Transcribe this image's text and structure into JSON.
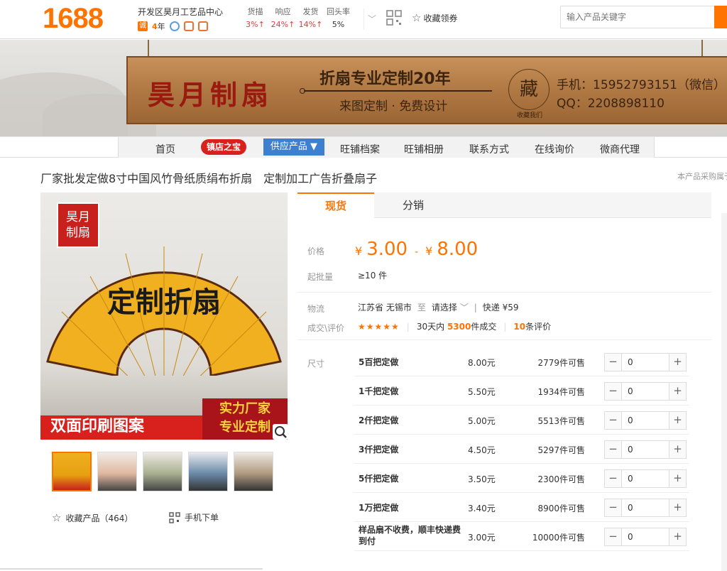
{
  "logo": "1688",
  "shop": {
    "name": "开发区昊月工艺品中心",
    "cheng": "诚",
    "years": "4",
    "years_unit": "年"
  },
  "stats": [
    {
      "label": "货描",
      "value": "3%↑"
    },
    {
      "label": "响应",
      "value": "24%↑"
    },
    {
      "label": "发货",
      "value": "14%↑"
    },
    {
      "label": "回头率",
      "value": "5%"
    }
  ],
  "favorite_coupon": "收藏领券",
  "search": {
    "placeholder": "输入产品关键字"
  },
  "banner": {
    "title": "昊月制扇",
    "slogan": "折扇专业定制20年",
    "sub": "来图定制 · 免费设计",
    "seal": "藏",
    "seal_caption": "收藏我们",
    "phone": "手机：15952793151（微信）",
    "qq": "QQ：2208898110"
  },
  "nav": {
    "home": "首页",
    "treasure": "镇店之宝",
    "supply": "供应产品 ▼",
    "archive": "旺铺档案",
    "album": "旺铺相册",
    "contact": "联系方式",
    "inquiry": "在线询价",
    "agent": "微商代理"
  },
  "product": {
    "title": "厂家批发定做8寸中国风竹骨纸质绢布折扇　定制加工广告折叠扇子",
    "purchase_note": "本产品采购属于"
  },
  "image": {
    "stamp": "昊月\n制扇",
    "red_text": "双面印刷图案",
    "red_right": "实力厂家\n专业定制",
    "fan_text": "定制折扇"
  },
  "collect": "收藏产品（464）",
  "mobile_order": "手机下单",
  "tabs": {
    "now": "现货",
    "dist": "分销"
  },
  "price": {
    "label": "价格",
    "yen": "¥",
    "low": "3.00",
    "dash": "-",
    "high": "8.00"
  },
  "min_batch": {
    "label": "起批量",
    "value": "≥10 件"
  },
  "logistics": {
    "label": "物流",
    "from": "江苏省 无锡市",
    "to_word": "至",
    "select": "请选择",
    "express": "快递 ¥59"
  },
  "deal": {
    "label": "成交\\评价",
    "stars": "★★★★★",
    "prefix": "30天内",
    "count": "5300",
    "suffix": "件成交",
    "reviews": "10",
    "reviews_suffix": "条评价"
  },
  "size_label": "尺寸",
  "rows": [
    {
      "name": "5百把定做",
      "price": "8.00元",
      "stock": "2779件可售",
      "qty": "0"
    },
    {
      "name": "1千把定做",
      "price": "5.50元",
      "stock": "1934件可售",
      "qty": "0"
    },
    {
      "name": "2仟把定做",
      "price": "5.00元",
      "stock": "5513件可售",
      "qty": "0"
    },
    {
      "name": "3仟把定做",
      "price": "4.50元",
      "stock": "5297件可售",
      "qty": "0"
    },
    {
      "name": "5仟把定做",
      "price": "3.50元",
      "stock": "2300件可售",
      "qty": "0"
    },
    {
      "name": "1万把定做",
      "price": "3.40元",
      "stock": "8900件可售",
      "qty": "0"
    },
    {
      "name": "样品扇不收费，顺丰快递费到付",
      "price": "3.00元",
      "stock": "10000件可售",
      "qty": "0"
    }
  ],
  "stepper": {
    "minus": "−",
    "plus": "+"
  }
}
